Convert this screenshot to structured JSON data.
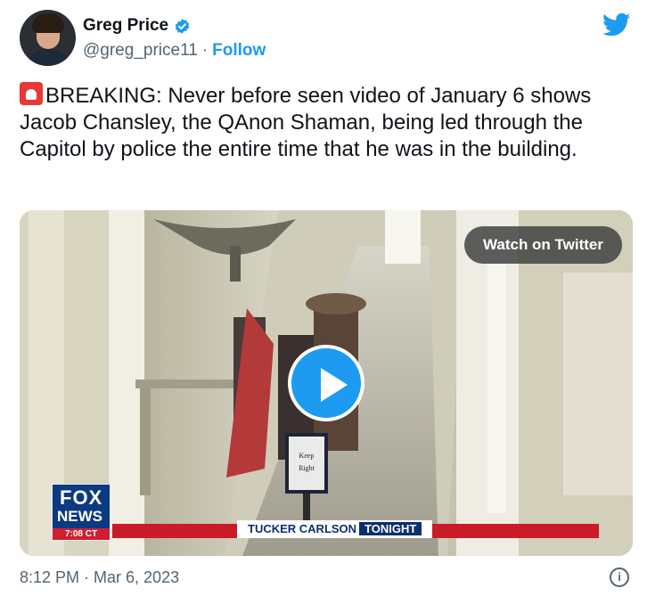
{
  "author": {
    "display_name": "Greg Price",
    "handle": "@greg_price11",
    "separator": "·",
    "follow_label": "Follow",
    "verified": true
  },
  "tweet": {
    "text": "BREAKING: Never before seen video of January 6 shows Jacob Chansley, the QAnon Shaman, being led through the Capitol by police the entire time that he was in the building.",
    "leading_emoji": "siren-icon"
  },
  "media": {
    "watch_label": "Watch on Twitter",
    "sign_text_1": "Keep",
    "sign_text_2": "Right",
    "network_logo": {
      "line1": "FOX",
      "line2": "NEWS",
      "time": "7:08 CT"
    },
    "ticker": {
      "show": "TUCKER CARLSON",
      "suffix": "TONIGHT"
    }
  },
  "footer": {
    "timestamp": "8:12 PM · Mar 6, 2023"
  },
  "colors": {
    "accent": "#1d9bf0",
    "text": "#0f1419",
    "muted": "#536471"
  },
  "icons": [
    "verified-badge-icon",
    "twitter-bird-icon",
    "siren-icon",
    "play-icon",
    "info-icon"
  ]
}
